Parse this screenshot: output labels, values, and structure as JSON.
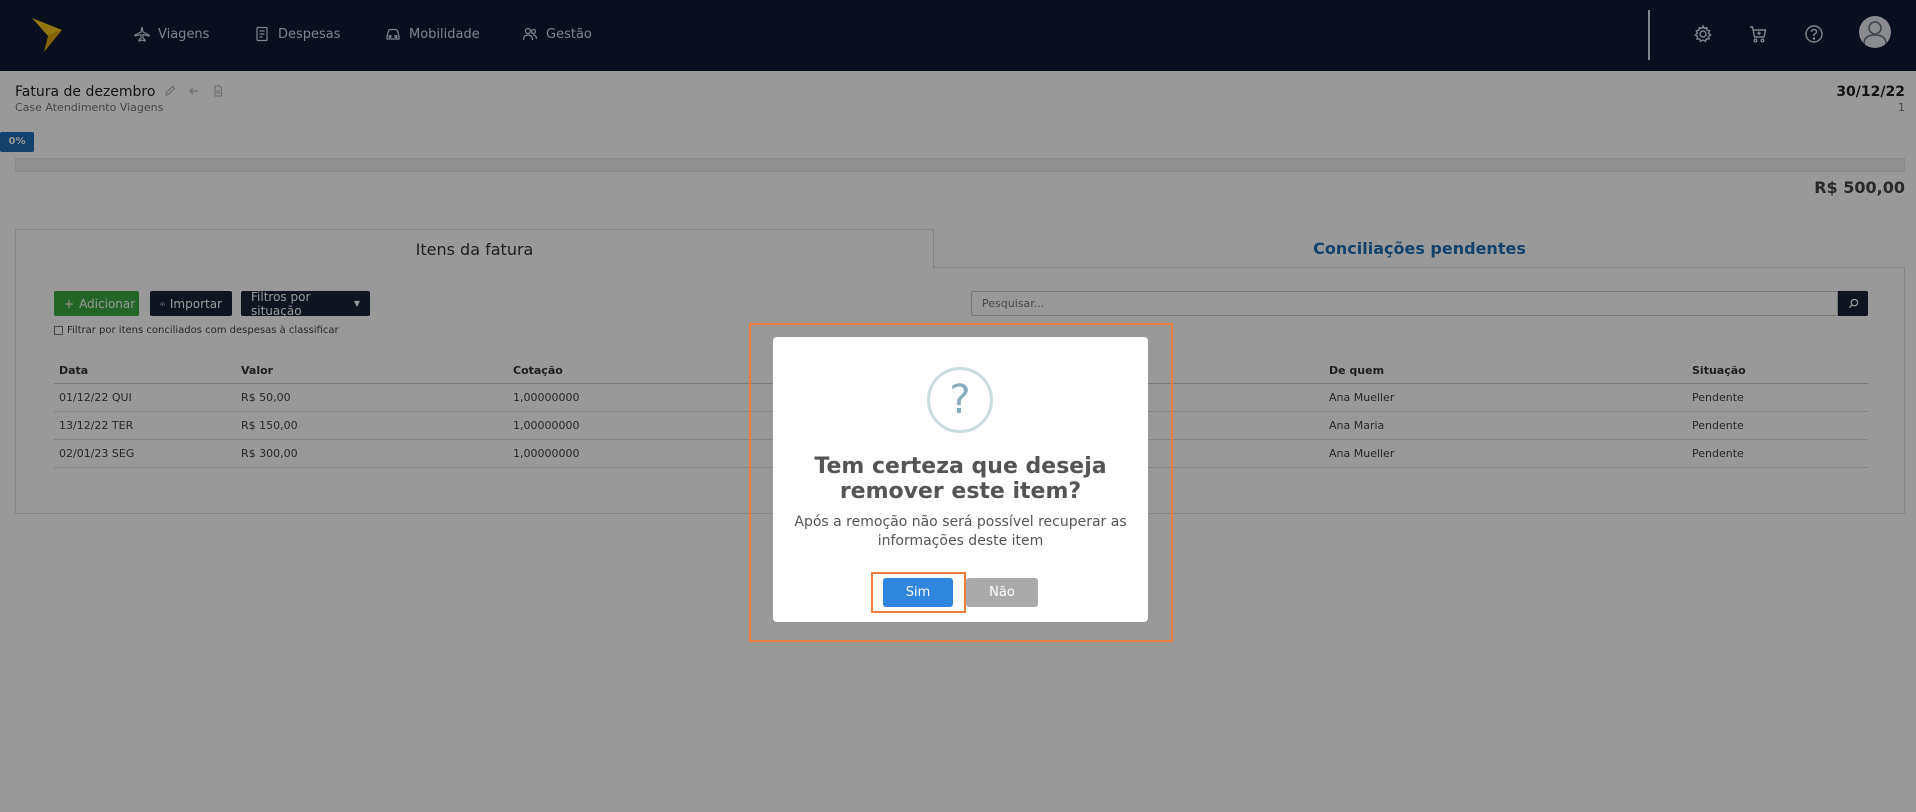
{
  "nav": {
    "items": [
      {
        "label": "Viagens",
        "icon": "airplane-icon"
      },
      {
        "label": "Despesas",
        "icon": "receipt-icon"
      },
      {
        "label": "Mobilidade",
        "icon": "car-icon"
      },
      {
        "label": "Gestão",
        "icon": "users-icon"
      }
    ],
    "right_icons": [
      "gear-icon",
      "cart-icon",
      "help-icon",
      "user-avatar"
    ]
  },
  "header": {
    "title": "Fatura de dezembro",
    "subtitle": "Case Atendimento Viagens",
    "date": "30/12/22",
    "count": "1"
  },
  "progress": {
    "label": "0%",
    "value": 0
  },
  "total": "R$ 500,00",
  "tabs": [
    {
      "label": "Itens da fatura",
      "active": true
    },
    {
      "label": "Conciliações pendentes",
      "active": false
    }
  ],
  "toolbar": {
    "add_label": "Adicionar",
    "import_label": "Importar",
    "filter_label": "Filtros por situação",
    "search_placeholder": "Pesquisar...",
    "check_label": "Filtrar por itens conciliados com despesas à classificar"
  },
  "table": {
    "columns": [
      "Data",
      "Valor",
      "Cotação",
      "De quem",
      "Situação"
    ],
    "rows": [
      {
        "data": "01/12/22 QUI",
        "valor": "R$ 50,00",
        "cotacao": "1,00000000",
        "de_quem": "Ana Mueller",
        "situacao": "Pendente"
      },
      {
        "data": "13/12/22 TER",
        "valor": "R$ 150,00",
        "cotacao": "1,00000000",
        "de_quem": "Ana Maria",
        "situacao": "Pendente"
      },
      {
        "data": "02/01/23 SEG",
        "valor": "R$ 300,00",
        "cotacao": "1,00000000",
        "de_quem": "Ana Mueller",
        "situacao": "Pendente"
      }
    ]
  },
  "modal": {
    "icon": "question-icon",
    "title_line1": "Tem certeza que deseja",
    "title_line2": "remover este item?",
    "text": "Após a remoção não será possível recuperar as informações deste item",
    "confirm_label": "Sim",
    "cancel_label": "Não"
  },
  "colors": {
    "navbar": "#0f1a33",
    "primary": "#2e86de",
    "success": "#3aa842",
    "pending": "#e8872f",
    "highlight": "#ee7d3c"
  }
}
